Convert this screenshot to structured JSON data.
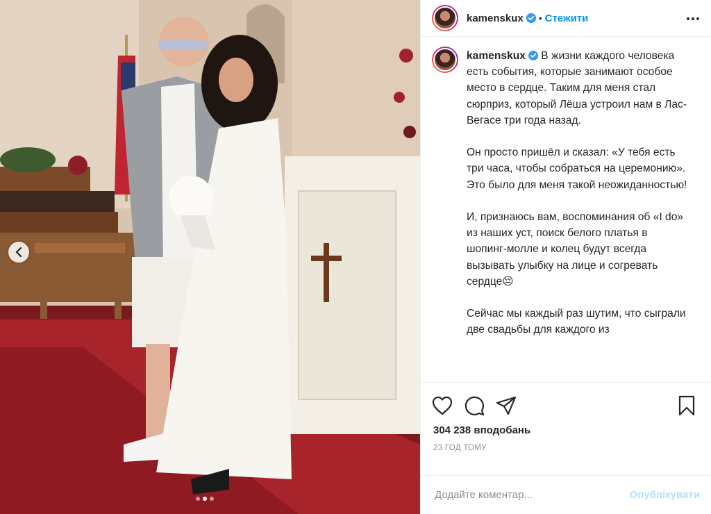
{
  "header": {
    "username": "kamenskux",
    "separator": "•",
    "follow_label": "Стежити"
  },
  "caption": {
    "username": "kamenskux",
    "paragraphs": [
      "В жизни каждого человека есть события, которые занимают особое место в сердце. Таким для меня стал сюрприз, который Лёша устроил нам в Лас-Вегасе три года назад.",
      "Он просто пришёл и сказал: «У тебя есть три часа, чтобы собраться на церемонию». Это было для меня такой неожиданностью!",
      "И, признаюсь вам, воспоминания об «I do» из наших уст, поиск белого платья в шопинг-молле и колец будут всегда вызывать улыбку на лице и согревать сердце😔",
      "Сейчас мы каждый раз шутим, что сыграли две свадьбы для каждого из"
    ]
  },
  "post": {
    "likes": "304 238 вподобань",
    "time": "23 ГОД ТОМУ",
    "carousel": {
      "slide_count": 3,
      "active_slide": 2
    }
  },
  "comment": {
    "placeholder": "Додайте коментар...",
    "publish_label": "Опублікувати"
  },
  "colors": {
    "link": "#0095f6",
    "publish_disabled": "#b2dffc",
    "muted": "#8e8e8e",
    "verified": "#3897f0"
  },
  "icons": [
    "chevron-left-icon",
    "more-options-icon",
    "verified-badge-icon",
    "heart-icon",
    "comment-icon",
    "share-icon",
    "bookmark-icon"
  ]
}
